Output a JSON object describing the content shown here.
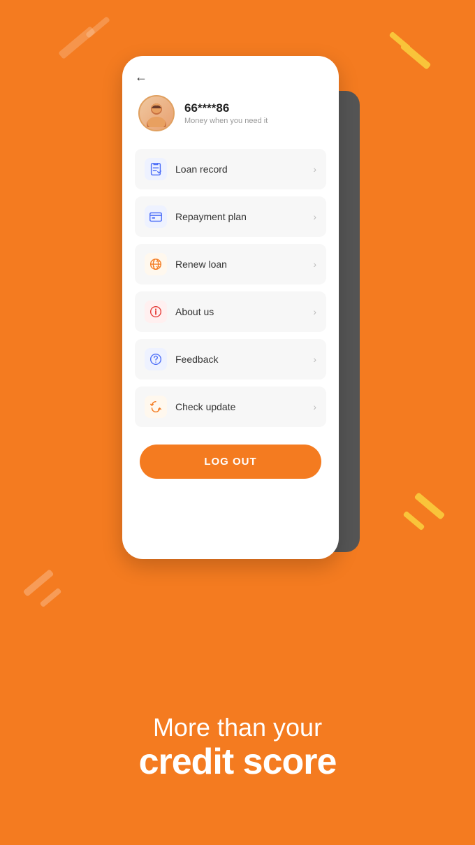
{
  "background": {
    "color": "#F47B20"
  },
  "phone": {
    "back_button": "←",
    "user": {
      "username": "66****86",
      "tagline": "Money when you need it"
    },
    "menu_items": [
      {
        "id": "loan-record",
        "label": "Loan record",
        "icon": "clipboard-icon",
        "icon_color": "blue"
      },
      {
        "id": "repayment-plan",
        "label": "Repayment plan",
        "icon": "card-icon",
        "icon_color": "blue"
      },
      {
        "id": "renew-loan",
        "label": "Renew loan",
        "icon": "globe-icon",
        "icon_color": "orange"
      },
      {
        "id": "about-us",
        "label": "About us",
        "icon": "info-icon",
        "icon_color": "red"
      },
      {
        "id": "feedback",
        "label": "Feedback",
        "icon": "question-icon",
        "icon_color": "blue"
      },
      {
        "id": "check-update",
        "label": "Check update",
        "icon": "refresh-icon",
        "icon_color": "orange"
      }
    ],
    "logout_button": "LOG OUT"
  },
  "bottom_text": {
    "line1": "More than your",
    "line2": "credit score"
  }
}
